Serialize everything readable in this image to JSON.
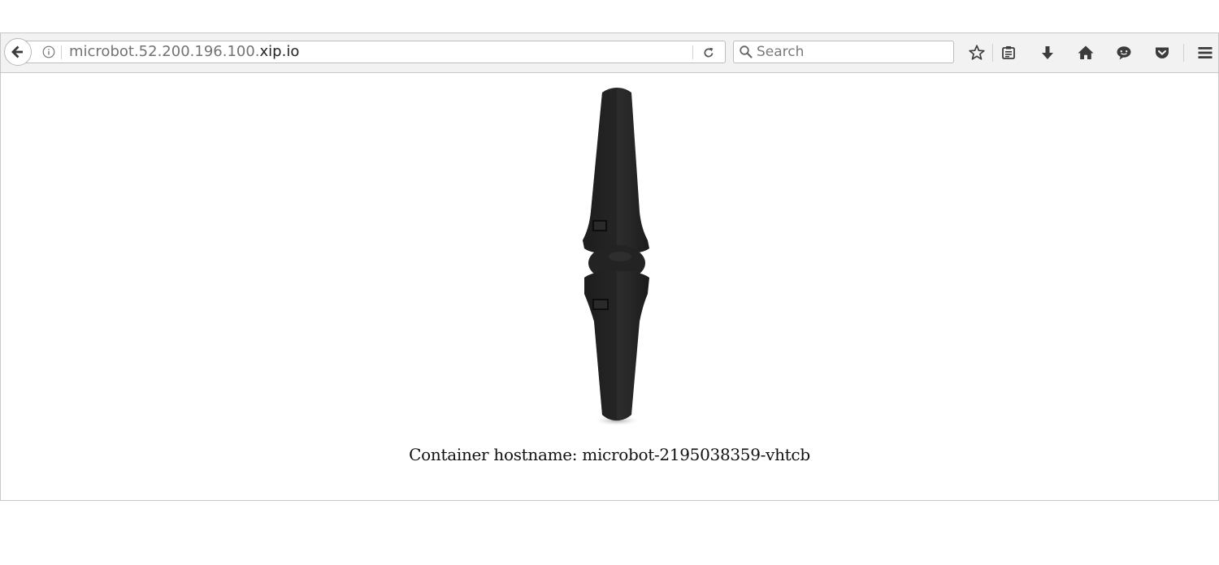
{
  "browser": {
    "url_prefix": "microbot.52.200.196.100.",
    "url_domain": "xip.io",
    "search_placeholder": "Search",
    "icons": {
      "back": "back-arrow-icon",
      "info": "info-icon",
      "reload": "reload-icon",
      "search": "search-icon",
      "bookmark": "star-icon",
      "reading_list": "clipboard-icon",
      "downloads": "download-arrow-icon",
      "home": "home-icon",
      "chat": "chat-bubble-icon",
      "pocket": "pocket-icon",
      "menu": "hamburger-menu-icon"
    }
  },
  "page": {
    "image": "microbot-robot-image",
    "hostname_text": "Container hostname: microbot-2195038359-vhtcb"
  },
  "colors": {
    "toolbar_bg": "#f2f2f2",
    "icon_color": "#3c3c3c",
    "robot_body": "#262626"
  }
}
